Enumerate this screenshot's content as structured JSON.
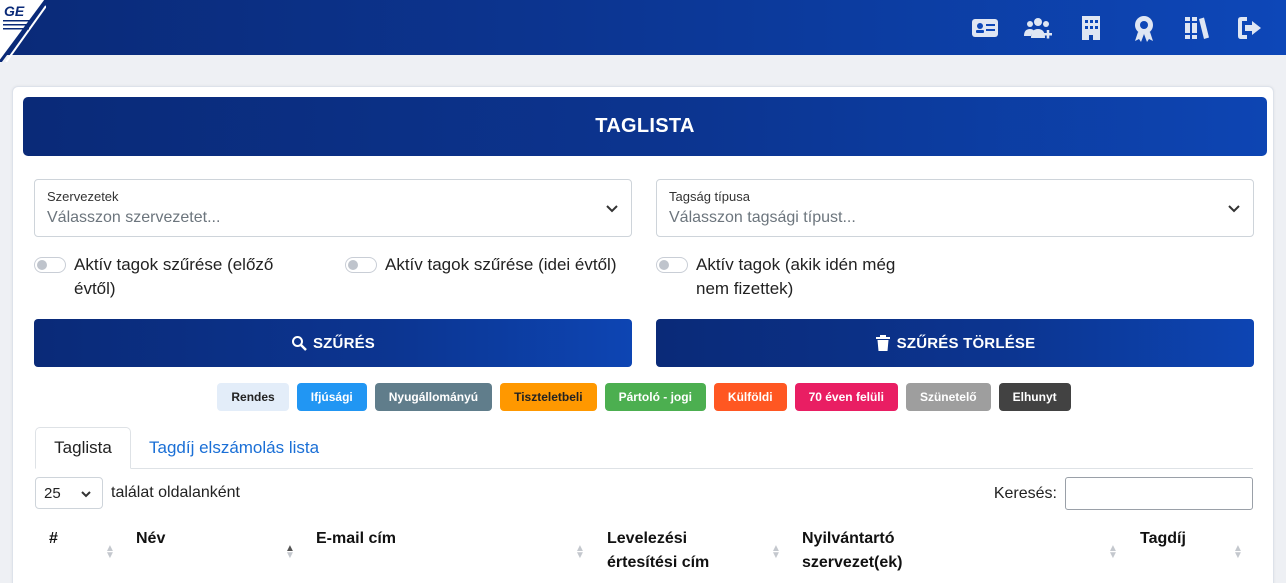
{
  "header": {
    "logo_text": "GE",
    "nav_icons": [
      "id-card-icon",
      "add-users-icon",
      "building-icon",
      "award-icon",
      "books-icon",
      "logout-icon"
    ]
  },
  "card": {
    "title": "TAGLISTA",
    "filters": {
      "org": {
        "label": "Szervezetek",
        "placeholder": "Válasszon szervezetet..."
      },
      "type": {
        "label": "Tagság típusa",
        "placeholder": "Válasszon tagsági típust..."
      }
    },
    "toggles": [
      "Aktív tagok szűrése (előző évtől)",
      "Aktív tagok szűrése (idei évtől)",
      "Aktív tagok (akik idén még nem fizettek)"
    ],
    "filter_button": "SZŰRÉS",
    "clear_button": "SZŰRÉS TÖRLÉSE"
  },
  "legend": [
    {
      "label": "Rendes",
      "bg": "#e3edf9",
      "fg": "#222222"
    },
    {
      "label": "Ifjúsági",
      "bg": "#2196f3",
      "fg": "#ffffff"
    },
    {
      "label": "Nyugállományú",
      "bg": "#607d8b",
      "fg": "#ffffff"
    },
    {
      "label": "Tiszteletbeli",
      "bg": "#ff9800",
      "fg": "#222222"
    },
    {
      "label": "Pártoló - jogi",
      "bg": "#4caf50",
      "fg": "#ffffff"
    },
    {
      "label": "Külföldi",
      "bg": "#ff5722",
      "fg": "#ffffff"
    },
    {
      "label": "70 éven felüli",
      "bg": "#e91e63",
      "fg": "#ffffff"
    },
    {
      "label": "Szünetelő",
      "bg": "#9e9e9e",
      "fg": "#ffffff"
    },
    {
      "label": "Elhunyt",
      "bg": "#424242",
      "fg": "#ffffff"
    }
  ],
  "tabs": {
    "active": "Taglista",
    "other": "Tagdíj elszámolás lista"
  },
  "table": {
    "page_size": "25",
    "page_size_text": "találat oldalanként",
    "search_label": "Keresés:",
    "columns": [
      "#",
      "Név",
      "E-mail cím",
      "Levelezési értesítési cím",
      "Nyilvántartó szervezet(ek)",
      "Tagdíj"
    ]
  }
}
